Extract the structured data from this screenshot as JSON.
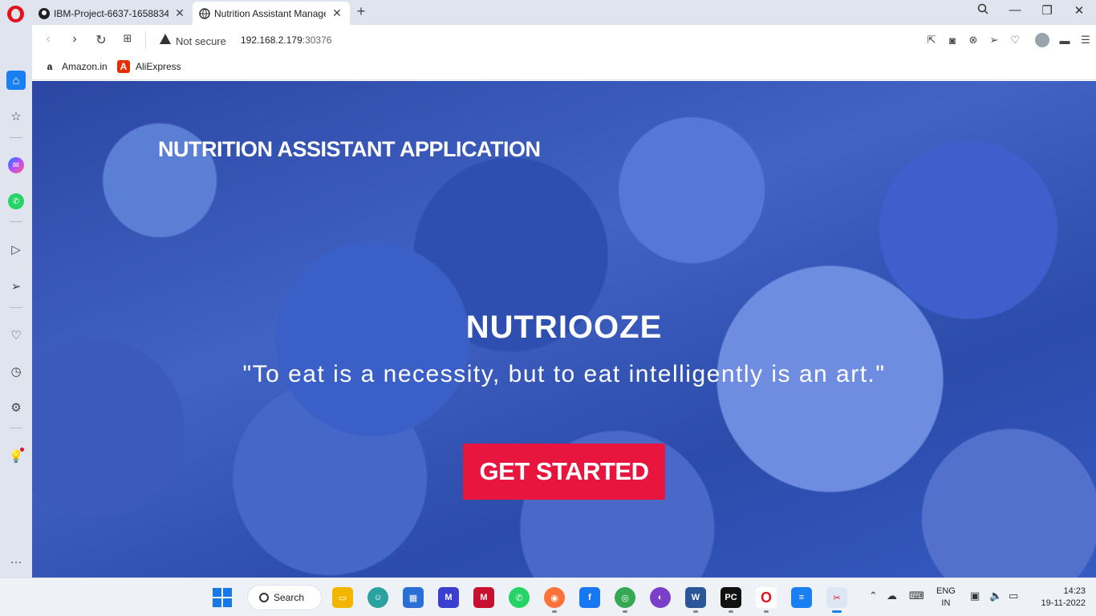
{
  "browser": {
    "tabs": [
      {
        "title": "IBM-Project-6637-1658834",
        "favicon": "github-icon",
        "active": false
      },
      {
        "title": "Nutrition Assistant Manage",
        "favicon": "globe-icon",
        "active": true
      }
    ],
    "address": {
      "security": "Not secure",
      "host": "192.168.2.179",
      "port": ":30376"
    },
    "bookmarks": [
      {
        "label": "Amazon.in",
        "icon": "amazon-icon"
      },
      {
        "label": "AliExpress",
        "icon": "aliexpress-icon"
      }
    ]
  },
  "page": {
    "header_title": "NUTRITION ASSISTANT APPLICATION",
    "brand": "NUTRIOOZE",
    "quote": "\"To eat is a necessity, but to eat intelligently is an art.\"",
    "cta_label": "GET STARTED",
    "cta_color": "#e8163f"
  },
  "taskbar": {
    "search_label": "Search",
    "language_top": "ENG",
    "language_bottom": "IN",
    "time": "14:23",
    "date": "19-11-2022"
  },
  "colors": {
    "accent": "#1a7ff0",
    "opera_red": "#e3121d"
  }
}
